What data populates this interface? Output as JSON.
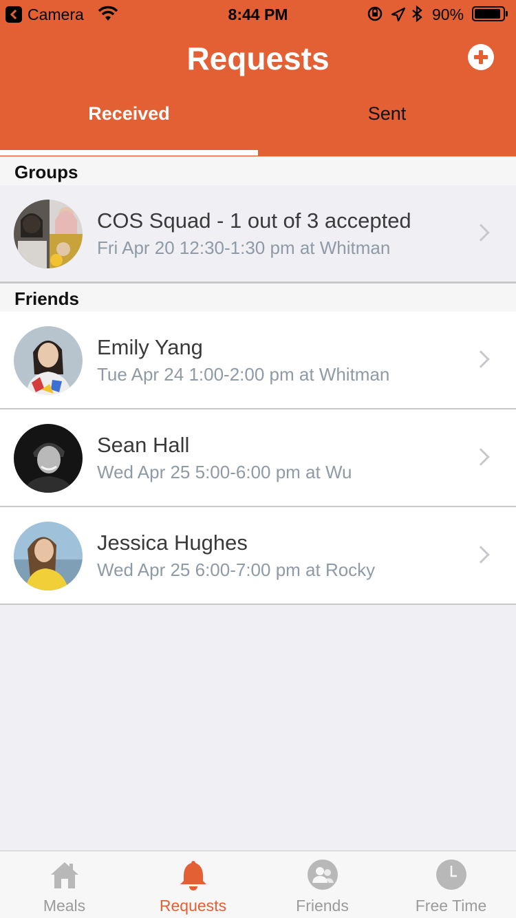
{
  "status_bar": {
    "carrier": "Camera",
    "time": "8:44 PM",
    "battery": "90%"
  },
  "header": {
    "title": "Requests",
    "tabs": [
      {
        "label": "Received",
        "active": true
      },
      {
        "label": "Sent",
        "active": false
      }
    ]
  },
  "sections": {
    "groups": {
      "label": "Groups",
      "items": [
        {
          "title": "COS Squad - 1 out of 3 accepted",
          "subtitle": "Fri Apr 20 12:30-1:30 pm at Whitman"
        }
      ]
    },
    "friends": {
      "label": "Friends",
      "items": [
        {
          "title": "Emily Yang",
          "subtitle": "Tue Apr 24 1:00-2:00 pm at Whitman"
        },
        {
          "title": "Sean Hall",
          "subtitle": "Wed Apr 25 5:00-6:00 pm at Wu"
        },
        {
          "title": "Jessica Hughes",
          "subtitle": "Wed Apr 25 6:00-7:00 pm at Rocky"
        }
      ]
    }
  },
  "tabbar": {
    "items": [
      {
        "label": "Meals",
        "icon": "house-icon"
      },
      {
        "label": "Requests",
        "icon": "bell-icon"
      },
      {
        "label": "Friends",
        "icon": "friends-icon"
      },
      {
        "label": "Free Time",
        "icon": "clock-icon"
      }
    ],
    "active": "Requests"
  },
  "colors": {
    "brand": "#e35f34",
    "background": "#efeff4",
    "subtitle": "#8e9aa6",
    "tab_inactive": "#9b9b9b"
  }
}
